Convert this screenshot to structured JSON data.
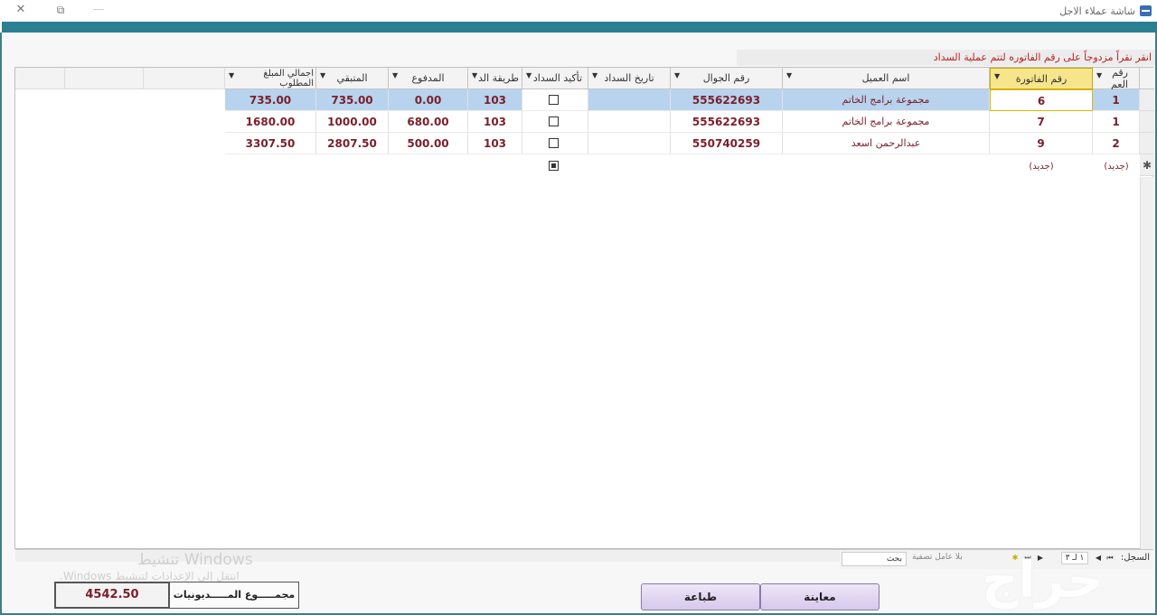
{
  "window": {
    "title": "شاشة عملاء الاجل",
    "close_glyph": "✕",
    "restore_glyph": "⧉",
    "minimize_glyph": "—"
  },
  "hint": "انقر نقراً مزدوجاً على رقم الفاتوره لتتم عملية السداد",
  "columns": [
    {
      "key": "num",
      "label": "رقم العم"
    },
    {
      "key": "invoice",
      "label": "رقم الفاتورة"
    },
    {
      "key": "customer",
      "label": "اسم العميل"
    },
    {
      "key": "mobile",
      "label": "رقم الجوال"
    },
    {
      "key": "pay_date",
      "label": "تاريخ السداد"
    },
    {
      "key": "confirm",
      "label": "تأكيد السداد"
    },
    {
      "key": "method",
      "label": "طريقة الد"
    },
    {
      "key": "paid",
      "label": "المدفوع"
    },
    {
      "key": "remaining",
      "label": "المتبقي"
    },
    {
      "key": "total",
      "label": "اجمالي المبلغ المطلوب"
    }
  ],
  "rows": [
    {
      "num": "1",
      "invoice": "6",
      "customer": "مجموعة برامج الخاتم",
      "mobile": "555622693",
      "pay_date": "",
      "confirm": false,
      "method": "103",
      "paid": "0.00",
      "remaining": "735.00",
      "total": "735.00"
    },
    {
      "num": "1",
      "invoice": "7",
      "customer": "مجموعة برامج الخاتم",
      "mobile": "555622693",
      "pay_date": "",
      "confirm": false,
      "method": "103",
      "paid": "680.00",
      "remaining": "1000.00",
      "total": "1680.00"
    },
    {
      "num": "2",
      "invoice": "9",
      "customer": "عبدالرحمن اسعد",
      "mobile": "550740259",
      "pay_date": "",
      "confirm": false,
      "method": "103",
      "paid": "500.00",
      "remaining": "2807.50",
      "total": "3307.50"
    }
  ],
  "new_row": {
    "marker": "✱",
    "num": "(جديد)",
    "invoice": "(جديد)",
    "confirm": true
  },
  "navigator": {
    "label": "السجل:",
    "position": "١ لـ ٣",
    "filter": "بلا عامل تصفية",
    "search": "بحث"
  },
  "watermark": {
    "line1": "تنشيط Windows",
    "line2": "انتقل إلى الإعدادات لتنشيط Windows."
  },
  "summary": {
    "label": "مجمـــــوع المـــــديونيات",
    "value": "4542.50"
  },
  "buttons": {
    "print": "طباعة",
    "preview": "معاينة"
  },
  "logo_text": "حراج"
}
